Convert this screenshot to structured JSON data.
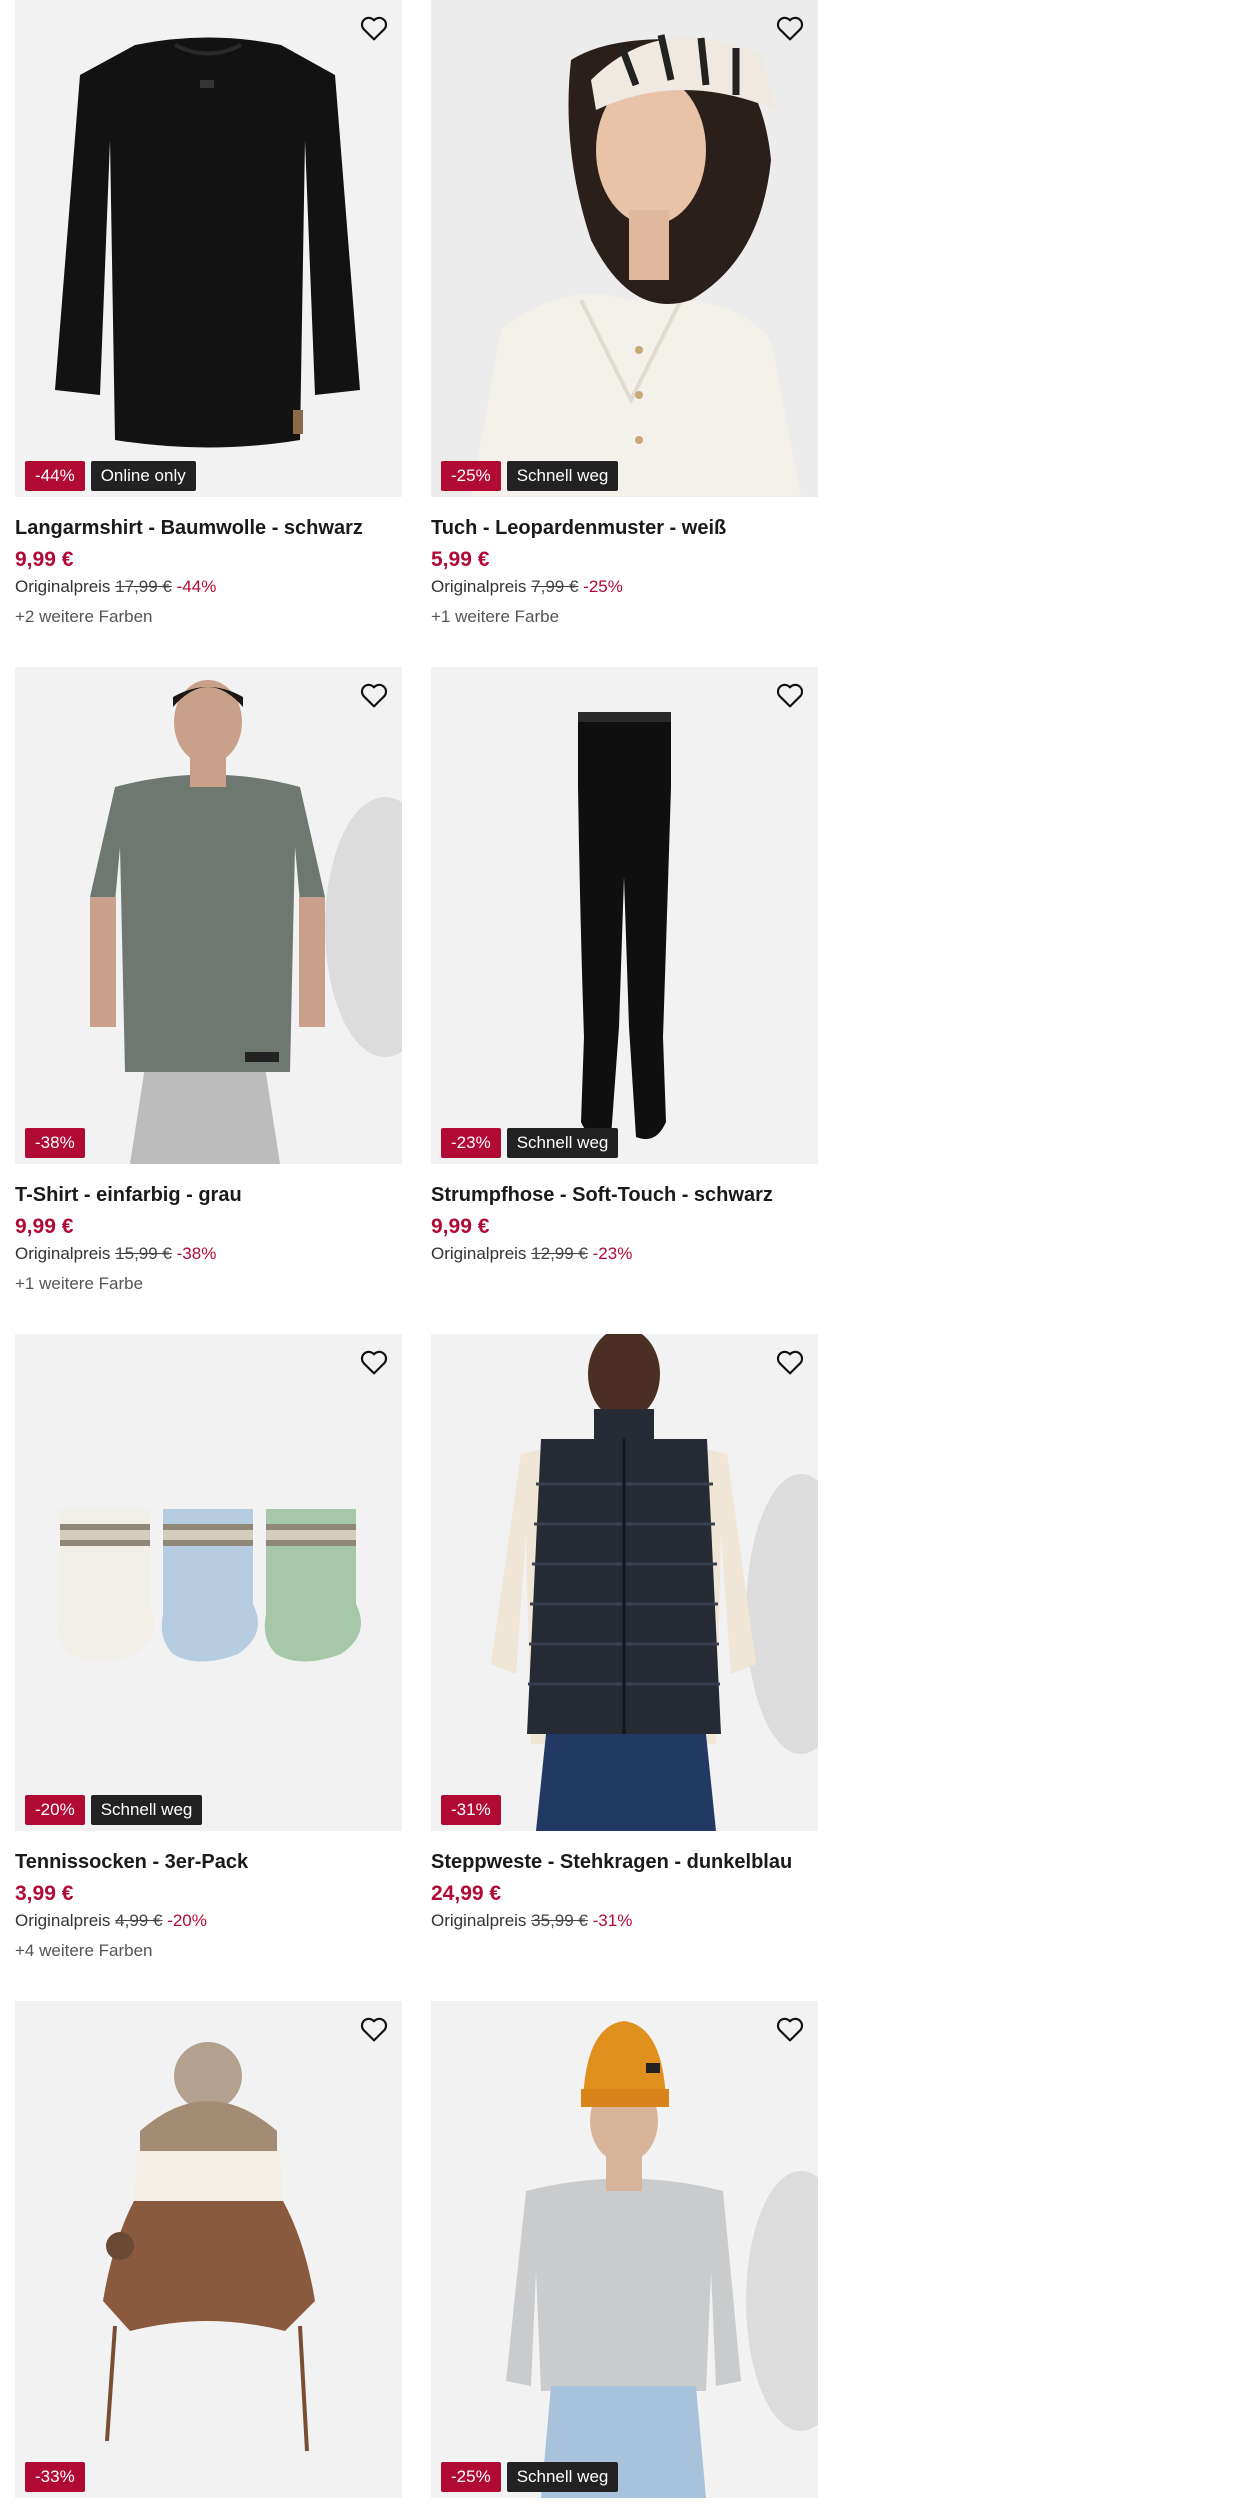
{
  "products": [
    {
      "name": "Langarmshirt - Baumwolle - schwarz",
      "price": "9,99 €",
      "orig_label": "Originalpreis",
      "orig_price": "17,99 €",
      "discount": "-44%",
      "badge_discount": "-44%",
      "badge_extra": "Online only",
      "more_colors": "+2 weitere Farben",
      "image_icon": "black-longsleeve-shirt"
    },
    {
      "name": "Tuch - Leopardenmuster - weiß",
      "price": "5,99 €",
      "orig_label": "Originalpreis",
      "orig_price": "7,99 €",
      "discount": "-25%",
      "badge_discount": "-25%",
      "badge_extra": "Schnell weg",
      "more_colors": "+1 weitere Farbe",
      "image_icon": "woman-with-headscarf"
    },
    {
      "name": "T-Shirt - einfarbig - grau",
      "price": "9,99 €",
      "orig_label": "Originalpreis",
      "orig_price": "15,99 €",
      "discount": "-38%",
      "badge_discount": "-38%",
      "badge_extra": "",
      "more_colors": "+1 weitere Farbe",
      "image_icon": "man-grey-tshirt"
    },
    {
      "name": "Strumpfhose - Soft-Touch - schwarz",
      "price": "9,99 €",
      "orig_label": "Originalpreis",
      "orig_price": "12,99 €",
      "discount": "-23%",
      "badge_discount": "-23%",
      "badge_extra": "Schnell weg",
      "more_colors": "",
      "image_icon": "black-tights"
    },
    {
      "name": "Tennissocken - 3er-Pack",
      "price": "3,99 €",
      "orig_label": "Originalpreis",
      "orig_price": "4,99 €",
      "discount": "-20%",
      "badge_discount": "-20%",
      "badge_extra": "Schnell weg",
      "more_colors": "+4 weitere Farben",
      "image_icon": "three-socks"
    },
    {
      "name": "Steppweste - Stehkragen - dunkelblau",
      "price": "24,99 €",
      "orig_label": "Originalpreis",
      "orig_price": "35,99 €",
      "discount": "-31%",
      "badge_discount": "-31%",
      "badge_extra": "",
      "more_colors": "",
      "image_icon": "man-puffer-vest"
    },
    {
      "name": "",
      "price": "",
      "orig_label": "",
      "orig_price": "",
      "discount": "",
      "badge_discount": "-33%",
      "badge_extra": "",
      "more_colors": "",
      "image_icon": "knit-baby-hat"
    },
    {
      "name": "",
      "price": "",
      "orig_label": "",
      "orig_price": "",
      "discount": "",
      "badge_discount": "-25%",
      "badge_extra": "Schnell weg",
      "more_colors": "",
      "image_icon": "man-grey-sweater-beanie"
    }
  ],
  "colors": {
    "sale": "#b10a35",
    "dark_badge": "#222222",
    "image_bg": "#f2f2f2"
  },
  "icons": {
    "favorite": "heart-outline-icon"
  }
}
